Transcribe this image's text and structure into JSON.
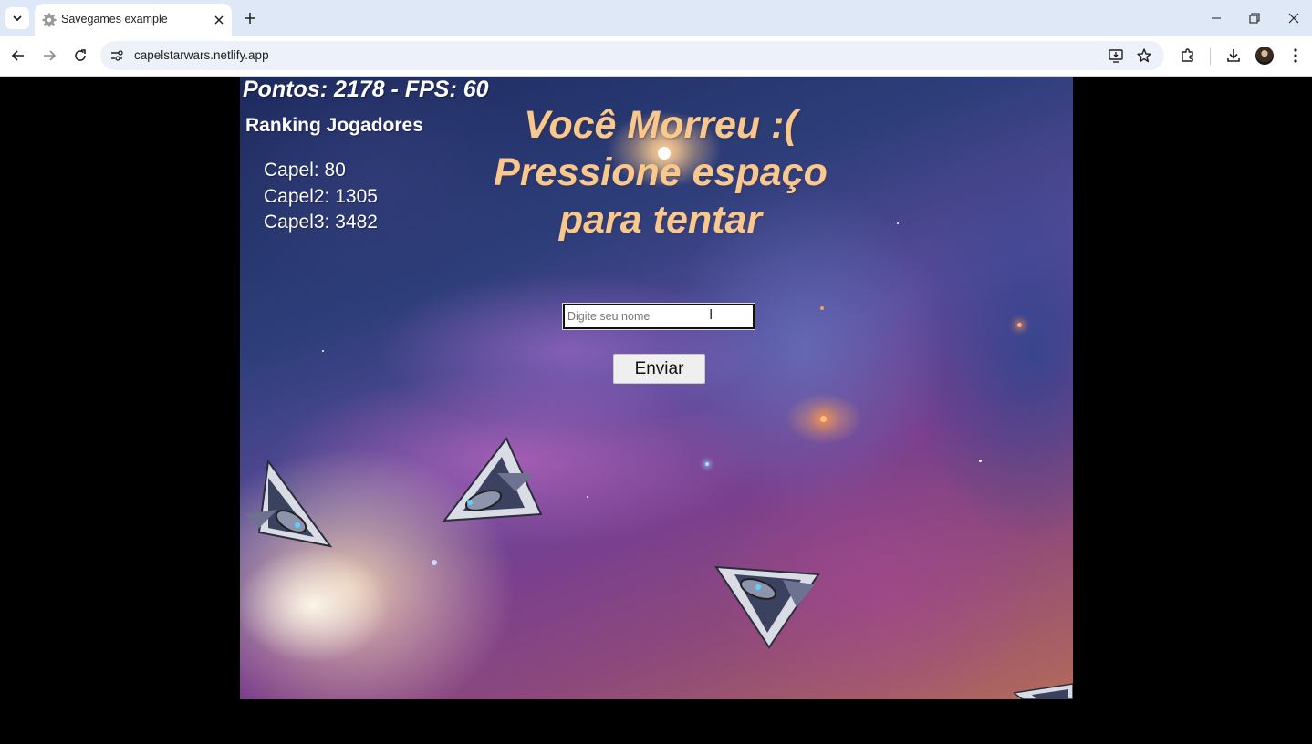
{
  "browser": {
    "tab_title": "Savegames example",
    "url": "capelstarwars.netlify.app",
    "icons": [
      "tab-list-icon",
      "settings-gear-favicon",
      "close-icon",
      "plus-icon",
      "minimize-icon",
      "restore-icon",
      "close-window-icon",
      "back-icon",
      "forward-icon",
      "reload-icon",
      "site-info-icon",
      "install-app-icon",
      "bookmark-star-icon",
      "extensions-icon",
      "downloads-icon",
      "profile-avatar",
      "more-menu-icon"
    ]
  },
  "game": {
    "score_text": "Pontos: 2178 - FPS: 60",
    "ranking": {
      "title": "Ranking Jogadores",
      "entries": [
        "Capel: 80",
        "Capel2: 1305",
        "Capel3: 3482"
      ]
    },
    "death_message": "Você Morreu :( Pressione espaço para tentar",
    "name_input": {
      "placeholder": "Digite seu nome",
      "value": ""
    },
    "submit_label": "Enviar"
  },
  "colors": {
    "death_text": "#f8c88f",
    "score_text": "#ffffff",
    "chrome_titlebar": "#dfe8f6",
    "omnibox": "#edf2fa"
  }
}
